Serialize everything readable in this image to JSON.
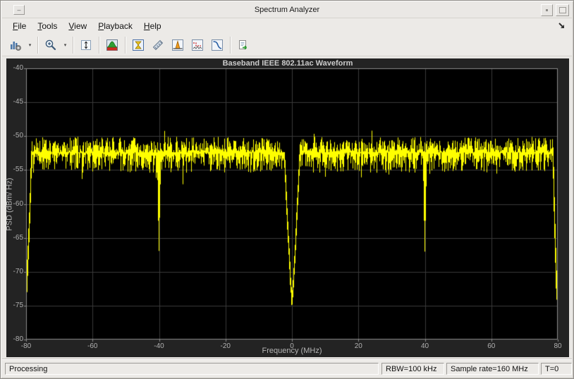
{
  "window": {
    "title": "Spectrum Analyzer"
  },
  "menu": {
    "items": [
      "File",
      "Tools",
      "View",
      "Playback",
      "Help"
    ]
  },
  "toolbar": {
    "icons": [
      "spectrum-config",
      "zoom-in",
      "fit-to-view",
      "spectrum-settings",
      "cursor-measurements",
      "distortion-measurements",
      "peak-finder",
      "spectral-mask",
      "ccdf-measurements",
      "export-data"
    ]
  },
  "plot": {
    "title": "Baseband IEEE 802.11ac Waveform",
    "xlabel": "Frequency (MHz)",
    "ylabel": "PSD (dBm/ Hz)"
  },
  "chart_data": {
    "type": "line",
    "title": "Baseband IEEE 802.11ac Waveform",
    "xlabel": "Frequency (MHz)",
    "ylabel": "PSD (dBm/ Hz)",
    "xlim": [
      -80,
      80
    ],
    "ylim": [
      -80,
      -40
    ],
    "x_ticks": [
      -80,
      -60,
      -40,
      -20,
      0,
      20,
      40,
      60,
      80
    ],
    "y_ticks": [
      -40,
      -45,
      -50,
      -55,
      -60,
      -65,
      -70,
      -75,
      -80
    ],
    "grid": true,
    "legend": "none",
    "line_color": "#ffff00",
    "plot_background": "#000000",
    "figure_background": "#232323",
    "grid_color": "#3a3a3a",
    "axis_color": "#8c8c8c",
    "noise_floor_dbm_hz": -52.4,
    "noise_ripple_high_db": 2.3,
    "noise_ripple_low_db": 3.0,
    "notches": [
      {
        "center_mhz": 0,
        "half_width_mhz": 2.4,
        "depth_dbm_hz": -75.3
      },
      {
        "center_mhz": -40,
        "half_width_mhz": 0.55,
        "depth_dbm_hz": -66.8
      },
      {
        "center_mhz": 40,
        "half_width_mhz": 0.55,
        "depth_dbm_hz": -66.9
      }
    ],
    "edges": [
      {
        "freq_mhz": -80,
        "level_dbm_hz": -72.6,
        "rolloff_start_mhz": -78.4
      },
      {
        "freq_mhz": 80,
        "level_dbm_hz": -74.6,
        "rolloff_start_mhz": 78.5
      }
    ]
  },
  "status": {
    "state": "Processing",
    "rbw": "RBW=100 kHz",
    "sample_rate": "Sample rate=160 MHz",
    "time": "T=0"
  },
  "colors": {
    "trace": "#ffff00",
    "chrome": "#eceae7",
    "status_border": "#9c9a96"
  }
}
